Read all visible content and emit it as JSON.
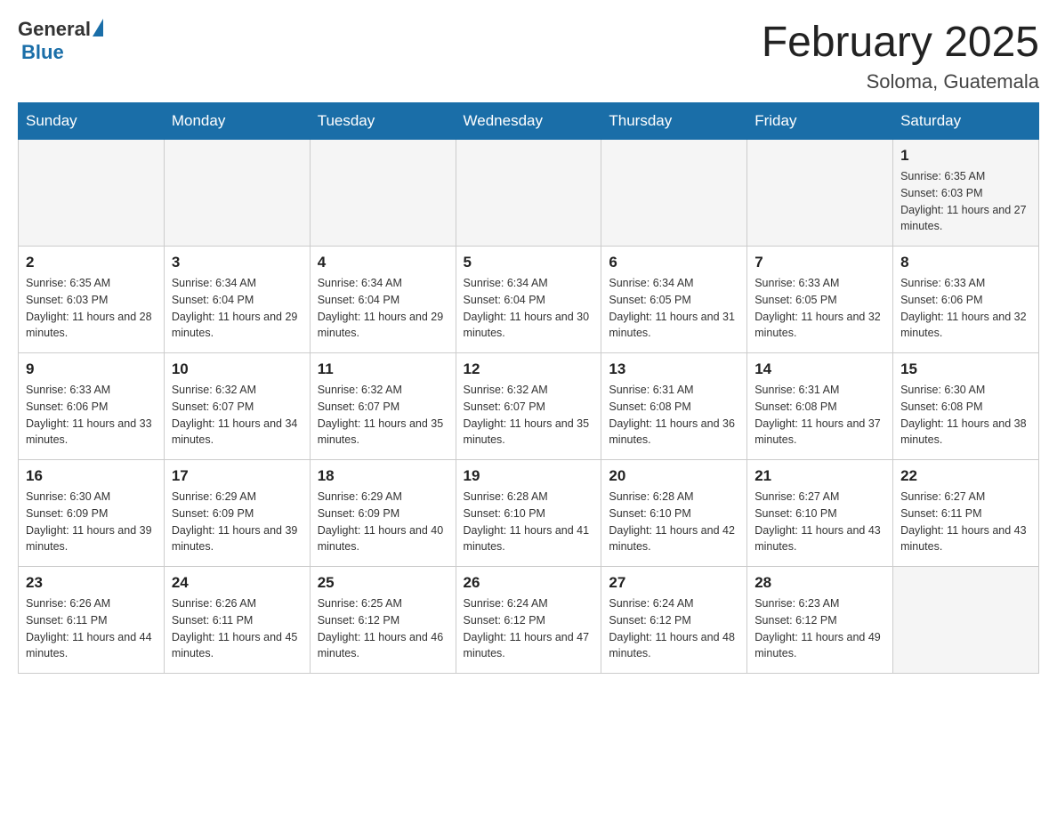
{
  "logo": {
    "general": "General",
    "blue": "Blue"
  },
  "title": "February 2025",
  "location": "Soloma, Guatemala",
  "days_of_week": [
    "Sunday",
    "Monday",
    "Tuesday",
    "Wednesday",
    "Thursday",
    "Friday",
    "Saturday"
  ],
  "weeks": [
    [
      {
        "day": "",
        "info": ""
      },
      {
        "day": "",
        "info": ""
      },
      {
        "day": "",
        "info": ""
      },
      {
        "day": "",
        "info": ""
      },
      {
        "day": "",
        "info": ""
      },
      {
        "day": "",
        "info": ""
      },
      {
        "day": "1",
        "info": "Sunrise: 6:35 AM\nSunset: 6:03 PM\nDaylight: 11 hours and 27 minutes."
      }
    ],
    [
      {
        "day": "2",
        "info": "Sunrise: 6:35 AM\nSunset: 6:03 PM\nDaylight: 11 hours and 28 minutes."
      },
      {
        "day": "3",
        "info": "Sunrise: 6:34 AM\nSunset: 6:04 PM\nDaylight: 11 hours and 29 minutes."
      },
      {
        "day": "4",
        "info": "Sunrise: 6:34 AM\nSunset: 6:04 PM\nDaylight: 11 hours and 29 minutes."
      },
      {
        "day": "5",
        "info": "Sunrise: 6:34 AM\nSunset: 6:04 PM\nDaylight: 11 hours and 30 minutes."
      },
      {
        "day": "6",
        "info": "Sunrise: 6:34 AM\nSunset: 6:05 PM\nDaylight: 11 hours and 31 minutes."
      },
      {
        "day": "7",
        "info": "Sunrise: 6:33 AM\nSunset: 6:05 PM\nDaylight: 11 hours and 32 minutes."
      },
      {
        "day": "8",
        "info": "Sunrise: 6:33 AM\nSunset: 6:06 PM\nDaylight: 11 hours and 32 minutes."
      }
    ],
    [
      {
        "day": "9",
        "info": "Sunrise: 6:33 AM\nSunset: 6:06 PM\nDaylight: 11 hours and 33 minutes."
      },
      {
        "day": "10",
        "info": "Sunrise: 6:32 AM\nSunset: 6:07 PM\nDaylight: 11 hours and 34 minutes."
      },
      {
        "day": "11",
        "info": "Sunrise: 6:32 AM\nSunset: 6:07 PM\nDaylight: 11 hours and 35 minutes."
      },
      {
        "day": "12",
        "info": "Sunrise: 6:32 AM\nSunset: 6:07 PM\nDaylight: 11 hours and 35 minutes."
      },
      {
        "day": "13",
        "info": "Sunrise: 6:31 AM\nSunset: 6:08 PM\nDaylight: 11 hours and 36 minutes."
      },
      {
        "day": "14",
        "info": "Sunrise: 6:31 AM\nSunset: 6:08 PM\nDaylight: 11 hours and 37 minutes."
      },
      {
        "day": "15",
        "info": "Sunrise: 6:30 AM\nSunset: 6:08 PM\nDaylight: 11 hours and 38 minutes."
      }
    ],
    [
      {
        "day": "16",
        "info": "Sunrise: 6:30 AM\nSunset: 6:09 PM\nDaylight: 11 hours and 39 minutes."
      },
      {
        "day": "17",
        "info": "Sunrise: 6:29 AM\nSunset: 6:09 PM\nDaylight: 11 hours and 39 minutes."
      },
      {
        "day": "18",
        "info": "Sunrise: 6:29 AM\nSunset: 6:09 PM\nDaylight: 11 hours and 40 minutes."
      },
      {
        "day": "19",
        "info": "Sunrise: 6:28 AM\nSunset: 6:10 PM\nDaylight: 11 hours and 41 minutes."
      },
      {
        "day": "20",
        "info": "Sunrise: 6:28 AM\nSunset: 6:10 PM\nDaylight: 11 hours and 42 minutes."
      },
      {
        "day": "21",
        "info": "Sunrise: 6:27 AM\nSunset: 6:10 PM\nDaylight: 11 hours and 43 minutes."
      },
      {
        "day": "22",
        "info": "Sunrise: 6:27 AM\nSunset: 6:11 PM\nDaylight: 11 hours and 43 minutes."
      }
    ],
    [
      {
        "day": "23",
        "info": "Sunrise: 6:26 AM\nSunset: 6:11 PM\nDaylight: 11 hours and 44 minutes."
      },
      {
        "day": "24",
        "info": "Sunrise: 6:26 AM\nSunset: 6:11 PM\nDaylight: 11 hours and 45 minutes."
      },
      {
        "day": "25",
        "info": "Sunrise: 6:25 AM\nSunset: 6:12 PM\nDaylight: 11 hours and 46 minutes."
      },
      {
        "day": "26",
        "info": "Sunrise: 6:24 AM\nSunset: 6:12 PM\nDaylight: 11 hours and 47 minutes."
      },
      {
        "day": "27",
        "info": "Sunrise: 6:24 AM\nSunset: 6:12 PM\nDaylight: 11 hours and 48 minutes."
      },
      {
        "day": "28",
        "info": "Sunrise: 6:23 AM\nSunset: 6:12 PM\nDaylight: 11 hours and 49 minutes."
      },
      {
        "day": "",
        "info": ""
      }
    ]
  ]
}
